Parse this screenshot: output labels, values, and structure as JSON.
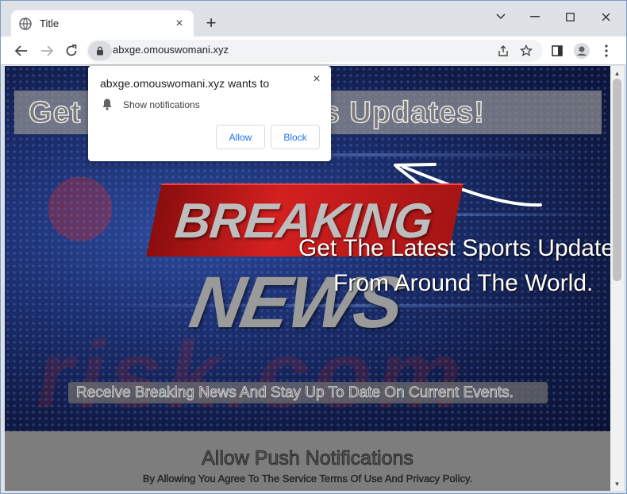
{
  "browser": {
    "tab": {
      "title": "Title",
      "favicon": "globe-icon"
    },
    "address_bar": {
      "url": "abxge.omouswomani.xyz"
    }
  },
  "page": {
    "headline": "Get The Latest News Updates!",
    "breaking": "BREAKING",
    "news": "NEWS",
    "sports_line_1": "Get The Latest Sports Updates",
    "sports_line_2": "From Around The World.",
    "subheading": "Receive Breaking News And Stay Up To Date On Current Events.",
    "bottom_title": "Allow Push Notifications",
    "bottom_subtitle": "By Allowing You Agree To The Service Terms Of Use And Privacy Policy.",
    "watermark": "risk.com"
  },
  "permission_popup": {
    "title": "abxge.omouswomani.xyz wants to",
    "permission": "Show notifications",
    "allow_label": "Allow",
    "block_label": "Block"
  },
  "colors": {
    "accent": "#1a73e8",
    "breaking_red": "#d42020",
    "page_bg": "#15204a"
  }
}
